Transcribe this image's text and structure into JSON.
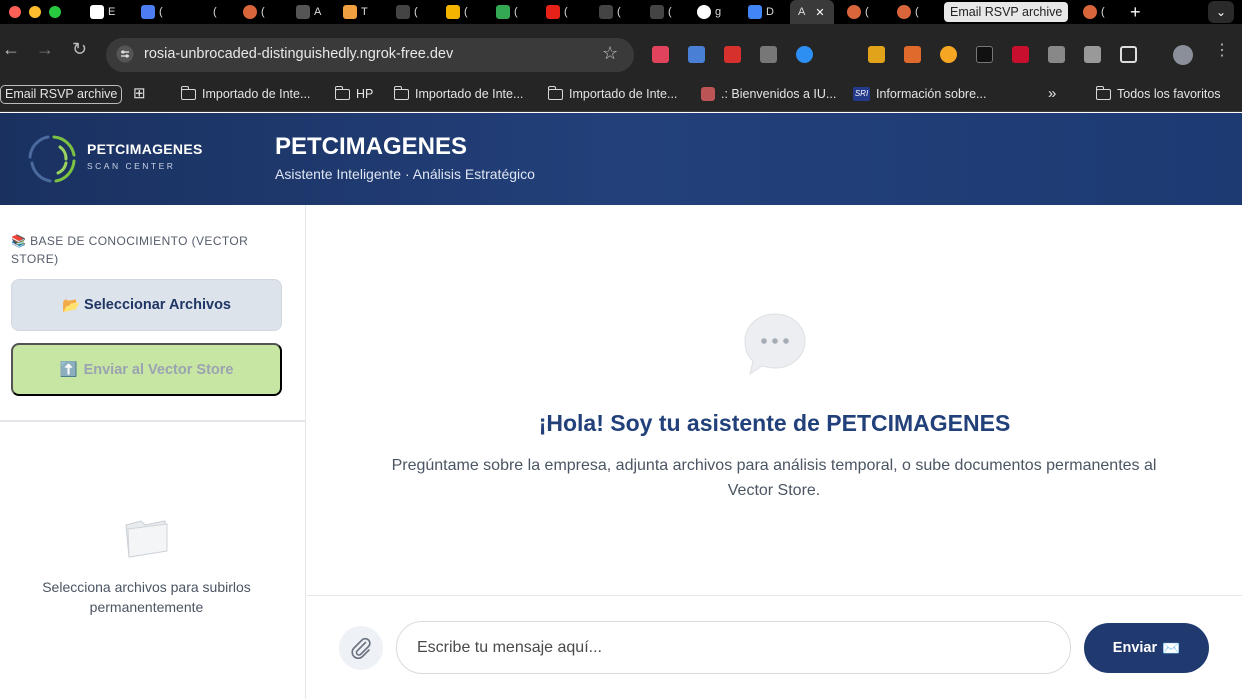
{
  "browser": {
    "tooltip": "Email RSVP archive",
    "tab_letters": [
      "E",
      "(",
      "(",
      "(",
      "A",
      "T",
      "(",
      "(",
      "(",
      "(",
      "(",
      "(",
      "g",
      "D",
      "A",
      "(",
      "(",
      "("
    ],
    "url": "rosia-unbrocaded-distinguishedly.ngrok-free.dev",
    "bookmarks": {
      "pill": "Email RSVP archive",
      "items": [
        "Importado de Inte...",
        "HP",
        "Importado de Inte...",
        "Importado de Inte...",
        ".: Bienvenidos a IU...",
        "Información sobre...",
        "Todos los favoritos"
      ],
      "more": "»"
    }
  },
  "header": {
    "logo_name": "PETCIMAGENES",
    "logo_sub": "SCAN CENTER",
    "title": "PETCIMAGENES",
    "subtitle": "Asistente Inteligente · Análisis Estratégico"
  },
  "sidebar": {
    "heading_icon": "📚",
    "heading": "BASE DE CONOCIMIENTO (VECTOR STORE)",
    "select_icon": "📂",
    "select_label": "Seleccionar Archivos",
    "send_icon": "⬆️",
    "send_label": "Enviar al Vector Store",
    "empty_text": "Selecciona archivos para subirlos permanentemente"
  },
  "chat": {
    "welcome_title": "¡Hola! Soy tu asistente de PETCIMAGENES",
    "welcome_text": "Pregúntame sobre la empresa, adjunta archivos para análisis temporal, o sube documentos permanentes al Vector Store.",
    "input_placeholder": "Escribe tu mensaje aquí...",
    "send_label": "Enviar",
    "send_icon": "✉️"
  },
  "colors": {
    "brand_navy": "#203a70",
    "header_gradient_start": "#1a3160",
    "send_vector_disabled": "#c8e6a3",
    "logo_green": "#7cc242"
  }
}
